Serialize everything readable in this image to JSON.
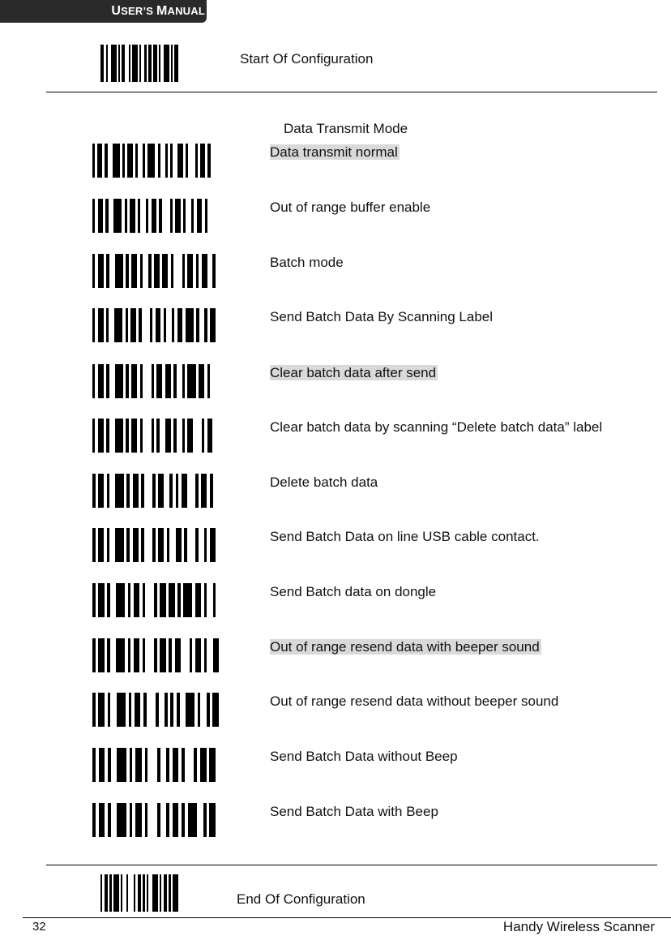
{
  "header": {
    "manual_label_parts": [
      "U",
      "SER",
      "’S ",
      "M",
      "ANUAL"
    ]
  },
  "start": {
    "label": "Start Of Configuration"
  },
  "section": {
    "title": "Data Transmit Mode",
    "items": [
      {
        "label": "Data transmit normal",
        "highlighted": true
      },
      {
        "label": "Out of range buffer enable",
        "highlighted": false
      },
      {
        "label": "Batch mode",
        "highlighted": false
      },
      {
        "label": "Send Batch Data By Scanning Label",
        "highlighted": false
      },
      {
        "label": "Clear batch data after send",
        "highlighted": true
      },
      {
        "label": "Clear batch data by scanning “Delete batch data” label",
        "highlighted": false
      },
      {
        "label": "Delete batch data",
        "highlighted": false
      },
      {
        "label": "Send Batch Data on line USB cable contact.",
        "highlighted": false
      },
      {
        "label": "Send Batch data on dongle",
        "highlighted": false
      },
      {
        "label": "Out of range resend data with beeper sound",
        "highlighted": true
      },
      {
        "label": "Out of range resend data without beeper sound",
        "highlighted": false
      },
      {
        "label": "Send Batch Data without Beep",
        "highlighted": false
      },
      {
        "label": "Send Batch Data with Beep",
        "highlighted": false
      }
    ]
  },
  "end": {
    "label": "End Of Configuration"
  },
  "footer": {
    "page_number": "32",
    "title": "Handy Wireless Scanner"
  }
}
